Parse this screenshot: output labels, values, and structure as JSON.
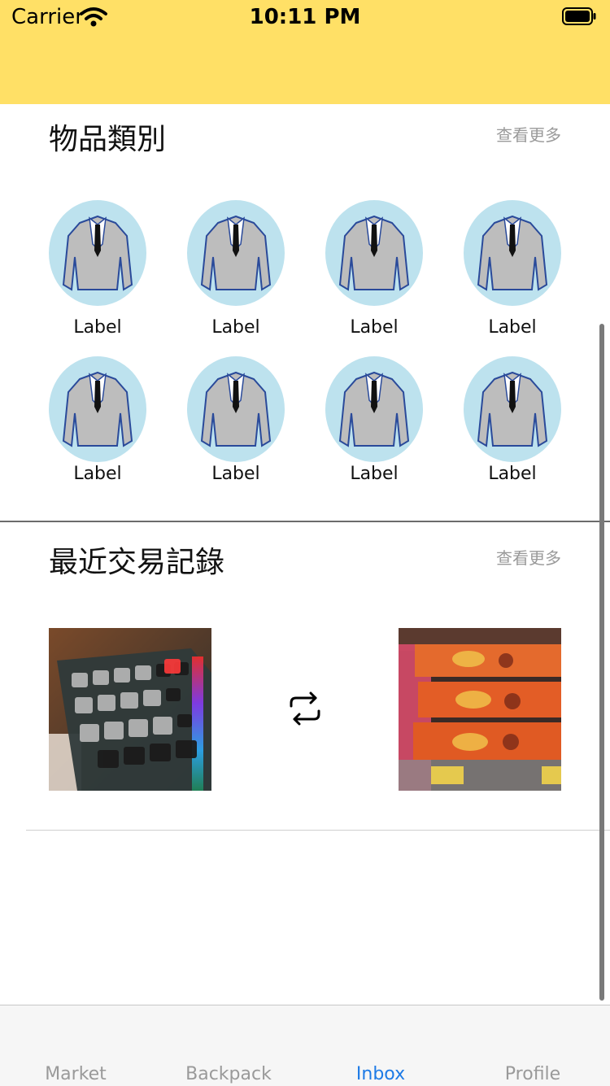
{
  "status_bar": {
    "carrier": "Carrier",
    "time": "10:11 PM"
  },
  "categories_section": {
    "title": "物品類別",
    "more_label": "查看更多",
    "items": [
      {
        "label": "Label"
      },
      {
        "label": "Label"
      },
      {
        "label": "Label"
      },
      {
        "label": "Label"
      },
      {
        "label": "Label"
      },
      {
        "label": "Label"
      },
      {
        "label": "Label"
      },
      {
        "label": "Label"
      }
    ]
  },
  "recent_section": {
    "title": "最近交易記錄",
    "more_label": "查看更多"
  },
  "tabbar": {
    "tabs": [
      {
        "label": "Market",
        "active": false
      },
      {
        "label": "Backpack",
        "active": false
      },
      {
        "label": "Inbox",
        "active": true
      },
      {
        "label": "Profile",
        "active": false
      }
    ]
  },
  "colors": {
    "header_bg": "#FFE066",
    "tab_active": "#1E7BE6",
    "tab_inactive": "#9A9A9A",
    "category_circle": "#BDE2EE"
  }
}
